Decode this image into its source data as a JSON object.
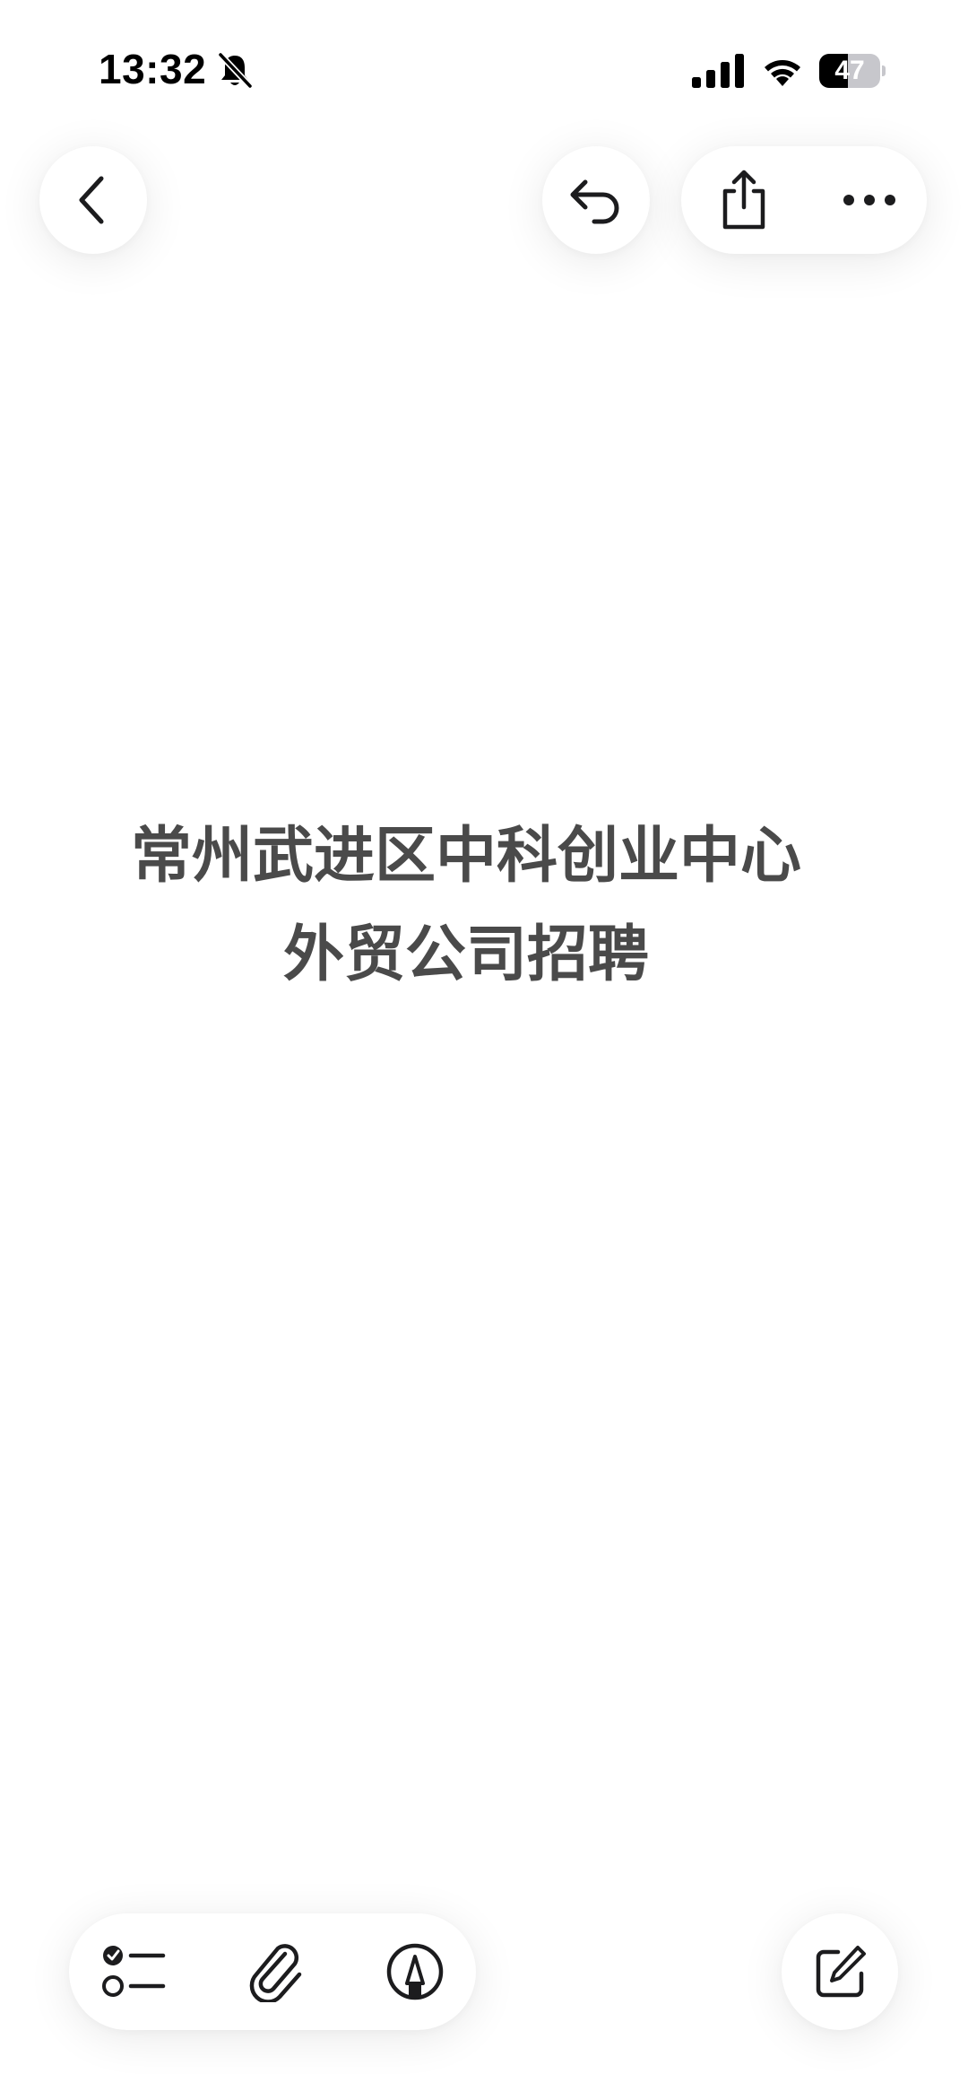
{
  "status_bar": {
    "time": "13:32",
    "battery_level": 47,
    "battery_label": "47",
    "mute_icon": "bell-slash-icon",
    "signal_icon": "cellular-signal-icon",
    "wifi_icon": "wifi-icon",
    "battery_icon": "battery-icon"
  },
  "top_nav": {
    "back_icon": "chevron-left-icon",
    "undo_icon": "undo-arrow-icon",
    "share_icon": "share-icon",
    "more_icon": "ellipsis-icon"
  },
  "note": {
    "lines": [
      "常州武进区中科创业中心",
      "外贸公司招聘"
    ],
    "text_color": "#4a4a4a"
  },
  "bottom_toolbar": {
    "checklist_icon": "checklist-icon",
    "attachment_icon": "paperclip-icon",
    "markup_icon": "markup-pen-icon",
    "compose_icon": "compose-icon"
  },
  "colors": {
    "background": "#ffffff",
    "icon": "#1c1c1e"
  }
}
